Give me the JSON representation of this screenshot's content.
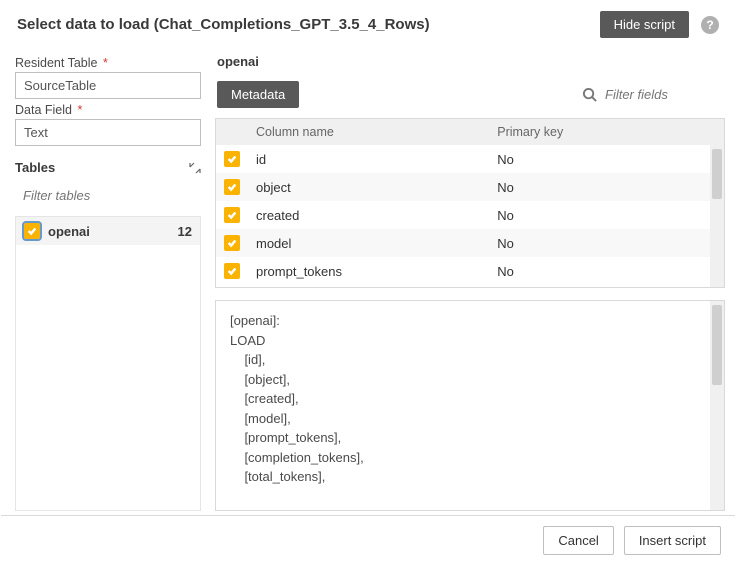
{
  "header": {
    "title": "Select data to load (Chat_Completions_GPT_3.5_4_Rows)",
    "hide_script_label": "Hide script"
  },
  "left": {
    "resident_table_label": "Resident Table",
    "resident_table_value": "SourceTable",
    "data_field_label": "Data Field",
    "data_field_value": "Text",
    "tables_label": "Tables",
    "filter_tables_placeholder": "Filter tables",
    "tables": [
      {
        "name": "openai",
        "count": "12",
        "checked": true
      }
    ]
  },
  "right": {
    "selected_table": "openai",
    "metadata_label": "Metadata",
    "filter_fields_placeholder": "Filter fields",
    "col_header_name": "Column name",
    "col_header_pk": "Primary key",
    "columns": [
      {
        "name": "id",
        "pk": "No",
        "checked": true
      },
      {
        "name": "object",
        "pk": "No",
        "checked": true
      },
      {
        "name": "created",
        "pk": "No",
        "checked": true
      },
      {
        "name": "model",
        "pk": "No",
        "checked": true
      },
      {
        "name": "prompt_tokens",
        "pk": "No",
        "checked": true
      }
    ],
    "script_lines": [
      "[openai]:",
      "LOAD",
      "    [id],",
      "    [object],",
      "    [created],",
      "    [model],",
      "    [prompt_tokens],",
      "    [completion_tokens],",
      "    [total_tokens],"
    ]
  },
  "footer": {
    "cancel_label": "Cancel",
    "insert_label": "Insert script"
  }
}
